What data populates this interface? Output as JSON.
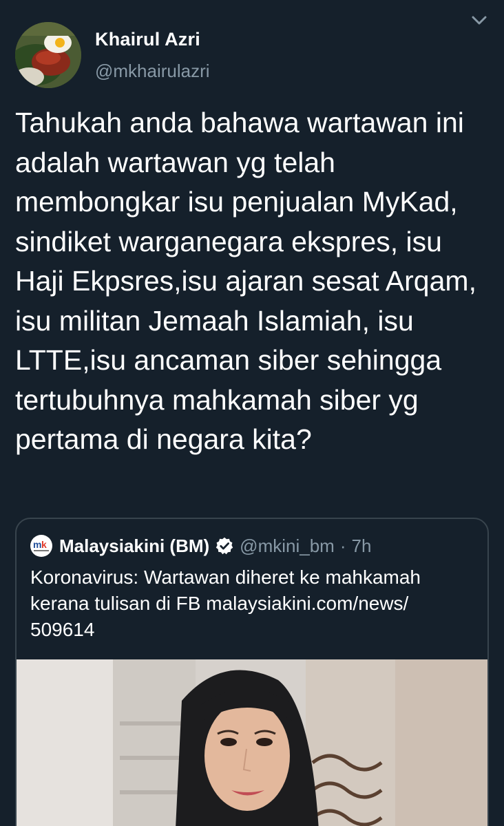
{
  "author": {
    "display_name": "Khairul Azri",
    "handle": "@mkhairulazri"
  },
  "tweet": {
    "text": "Tahukah anda bahawa wartawan ini adalah wartawan yg telah membongkar isu penjualan MyKad, sindiket warganegara ekspres, isu Haji Ekpsres,isu ajaran sesat Arqam, isu militan Jemaah Islamiah, isu LTTE,isu ancaman siber  sehingga tertubuhnya mahkamah siber yg pertama di negara kita?"
  },
  "quoted_tweet": {
    "display_name": "Malaysiakini (BM)",
    "handle": "@mkini_bm",
    "separator": "·",
    "time": "7h",
    "text": "Koronavirus: Wartawan diheret ke mahkamah kerana tulisan di FB malaysiakini.com/news/ 509614"
  },
  "icons": {
    "caret": "chevron-down-icon",
    "verified": "verified-badge-icon"
  },
  "colors": {
    "background": "#15202b",
    "secondary_text": "#8899a6",
    "border": "#38444d",
    "verified": "#ffffff"
  }
}
